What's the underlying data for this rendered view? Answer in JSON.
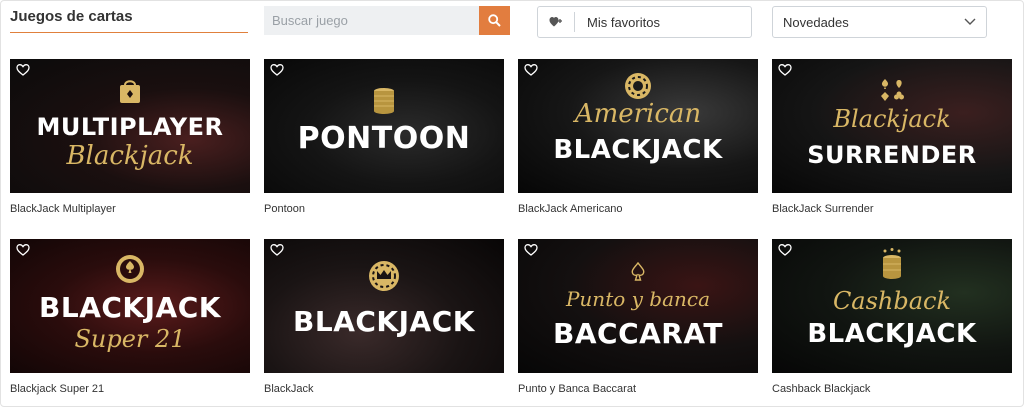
{
  "header": {
    "title": "Juegos de cartas",
    "search_placeholder": "Buscar juego",
    "favorites_label": "Mis favoritos",
    "sort_label": "Novedades"
  },
  "colors": {
    "accent": "#e27d3f",
    "gold": "#d9b765"
  },
  "games": [
    {
      "name": "BlackJack Multiplayer",
      "logo_line1": "MULTIPLAYER",
      "logo_line2": "Blackjack"
    },
    {
      "name": "Pontoon",
      "logo_line1": "PONTOON",
      "logo_line2": ""
    },
    {
      "name": "BlackJack Americano",
      "logo_line1": "American",
      "logo_line2": "BLACKJACK"
    },
    {
      "name": "BlackJack Surrender",
      "logo_line1": "Blackjack",
      "logo_line2": "SURRENDER"
    },
    {
      "name": "Blackjack Super 21",
      "logo_line1": "BLACKJACK",
      "logo_line2": "Super 21"
    },
    {
      "name": "BlackJack",
      "logo_line1": "BLACKJACK",
      "logo_line2": ""
    },
    {
      "name": "Punto y Banca Baccarat",
      "logo_line1": "Punto y banca",
      "logo_line2": "BACCARAT"
    },
    {
      "name": "Cashback Blackjack",
      "logo_line1": "Cashback",
      "logo_line2": "BLACKJACK"
    }
  ]
}
